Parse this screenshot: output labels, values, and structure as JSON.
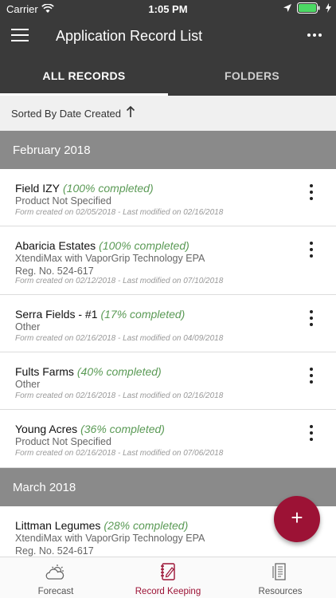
{
  "status_bar": {
    "carrier": "Carrier",
    "time": "1:05 PM"
  },
  "app_bar": {
    "title": "Application Record List"
  },
  "tabs": [
    {
      "label": "ALL RECORDS",
      "active": true
    },
    {
      "label": "FOLDERS",
      "active": false
    }
  ],
  "sort": {
    "label": "Sorted By Date Created",
    "direction": "ascending"
  },
  "sections": [
    {
      "title": "February 2018"
    },
    {
      "title": "March 2018"
    }
  ],
  "records": [
    {
      "name": "Field IZY",
      "progress": "(100% completed)",
      "product": "Product Not Specified",
      "product2": "",
      "meta": "Form created on 02/05/2018 - Last modified on 02/16/2018"
    },
    {
      "name": "Abaricia Estates",
      "progress": "(100% completed)",
      "product": "XtendiMax with VaporGrip Technology EPA",
      "product2": "Reg. No. 524-617",
      "meta": "Form created on 02/12/2018 - Last modified on 07/10/2018"
    },
    {
      "name": "Serra Fields - #1",
      "progress": "(17% completed)",
      "product": "Other",
      "product2": "",
      "meta": "Form created on 02/16/2018 - Last modified on 04/09/2018"
    },
    {
      "name": "Fults Farms",
      "progress": "(40% completed)",
      "product": "Other",
      "product2": "",
      "meta": "Form created on 02/16/2018 - Last modified on 02/16/2018"
    },
    {
      "name": "Young Acres",
      "progress": "(36% completed)",
      "product": "Product Not Specified",
      "product2": "",
      "meta": "Form created on 02/16/2018 - Last modified on 07/06/2018"
    },
    {
      "name": "Littman Legumes",
      "progress": "(28% completed)",
      "product": "XtendiMax with VaporGrip Technology EPA",
      "product2": "Reg. No. 524-617",
      "meta": ""
    }
  ],
  "fab": {
    "symbol": "+",
    "icon": "add-icon"
  },
  "bottom_nav": [
    {
      "label": "Forecast",
      "icon": "weather-icon",
      "active": false
    },
    {
      "label": "Record Keeping",
      "icon": "notebook-icon",
      "active": true
    },
    {
      "label": "Resources",
      "icon": "document-icon",
      "active": false
    }
  ],
  "colors": {
    "app_bar": "#3a3a3a",
    "accent": "#9c1235",
    "progress_text": "#5a9a55",
    "section_header": "#8a8a8a"
  }
}
